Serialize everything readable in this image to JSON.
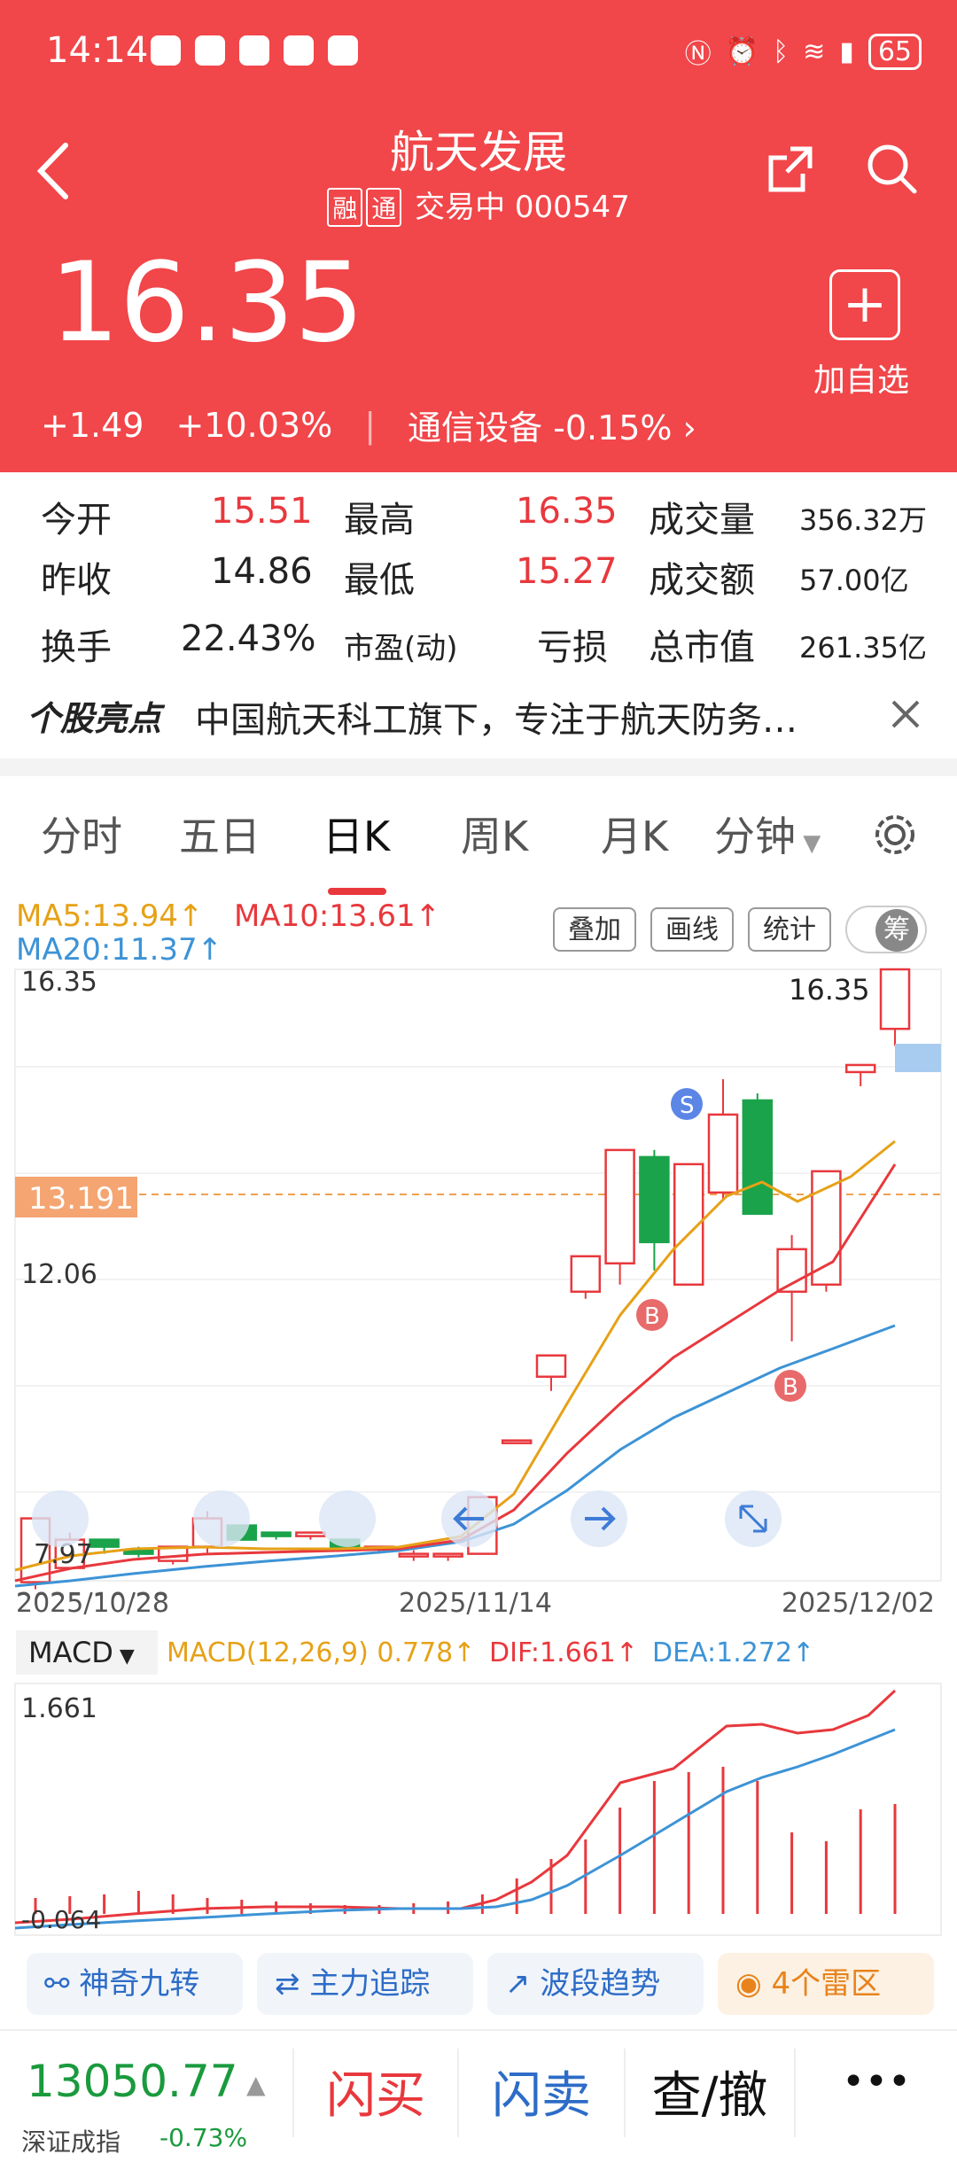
{
  "status_bar": {
    "time": "14:14",
    "battery": "65"
  },
  "header": {
    "title": "航天发展",
    "tags": [
      "融",
      "通"
    ],
    "trading_status": "交易中",
    "code": "000547",
    "price": "16.35",
    "change": "+1.49",
    "change_pct": "+10.03%",
    "sector": "通信设备",
    "sector_pct": "-0.15%",
    "add_watchlist": "加自选"
  },
  "stats": [
    {
      "label": "今开",
      "value": "15.51"
    },
    {
      "label": "最高",
      "value": "16.35"
    },
    {
      "label": "成交量",
      "value": "356.32万"
    },
    {
      "label": "昨收",
      "value": "14.86"
    },
    {
      "label": "最低",
      "value": "15.27"
    },
    {
      "label": "成交额",
      "value": "57.00亿"
    },
    {
      "label": "换手",
      "value": "22.43%"
    },
    {
      "label": "市盈(动)",
      "value": "亏损"
    },
    {
      "label": "总市值",
      "value": "261.35亿"
    }
  ],
  "highlight": {
    "brand": "个股亮点",
    "text": "中国航天科工旗下，专注于航天防务…"
  },
  "tabs": [
    "分时",
    "五日",
    "日K",
    "周K",
    "月K",
    "分钟"
  ],
  "chart": {
    "ma5": "MA5:13.94↑",
    "ma10": "MA10:13.61↑",
    "ma20": "MA20:11.37↑",
    "buttons": [
      "叠加",
      "画线",
      "统计",
      "筹"
    ],
    "y_top": "16.35",
    "y_mid": "12.06",
    "y_low": "7.97",
    "current_line": "13.191",
    "high_label": "16.35",
    "dates": [
      "2025/10/28",
      "2025/11/14",
      "2025/12/02"
    ],
    "signal_s": "S",
    "signal_b": "B"
  },
  "macd": {
    "selector": "MACD",
    "macd": "MACD(12,26,9)  0.778↑",
    "dif": "DIF:1.661↑",
    "dea": "DEA:1.272↑",
    "y_top": "1.661",
    "y_low": "-0.064"
  },
  "features": [
    "神奇九转",
    "主力追踪",
    "波段趋势",
    "4个雷区"
  ],
  "bottom": {
    "index_value": "13050.77",
    "index_name": "深证成指",
    "index_pct": "-0.73%",
    "buy": "闪买",
    "sell": "闪卖",
    "query": "查/撤",
    "more": "•••"
  },
  "chart_data": {
    "type": "candlestick",
    "x_start": "2025/10/28",
    "x_end": "2025/12/02",
    "ylim": [
      7.97,
      16.35
    ],
    "candles": [
      [
        8.6,
        7.7,
        7.97,
        7.6,
        "up"
      ],
      [
        8.3,
        7.9,
        8.4,
        8.2,
        "up"
      ],
      [
        8.2,
        8.3,
        8.3,
        8.1,
        "down"
      ],
      [
        8.1,
        8.15,
        8.2,
        8.05,
        "down"
      ],
      [
        8.0,
        8.2,
        8.1,
        7.95,
        "up"
      ],
      [
        8.2,
        8.6,
        8.7,
        8.1,
        "up"
      ],
      [
        8.3,
        8.5,
        8.4,
        8.3,
        "down"
      ],
      [
        8.35,
        8.4,
        8.4,
        8.3,
        "down"
      ],
      [
        8.4,
        8.35,
        8.35,
        8.3,
        "up"
      ],
      [
        8.3,
        8.2,
        8.3,
        8.15,
        "down"
      ],
      [
        8.2,
        8.2,
        8.2,
        8.1,
        "up"
      ],
      [
        8.1,
        8.1,
        8.15,
        8.0,
        "up"
      ],
      [
        8.1,
        8.1,
        8.1,
        8.0,
        "up"
      ],
      [
        8.1,
        8.9,
        8.9,
        8.1,
        "up"
      ],
      [
        9.7,
        9.7,
        9.7,
        9.7,
        "up"
      ],
      [
        10.6,
        10.9,
        10.9,
        10.4,
        "up"
      ],
      [
        11.8,
        12.3,
        12.3,
        11.7,
        "up"
      ],
      [
        12.2,
        13.8,
        13.8,
        11.9,
        "up"
      ],
      [
        13.7,
        12.5,
        13.8,
        12.1,
        "down"
      ],
      [
        11.9,
        13.6,
        13.6,
        11.9,
        "up"
      ],
      [
        13.2,
        14.3,
        14.8,
        13.1,
        "up"
      ],
      [
        14.5,
        12.9,
        14.6,
        12.9,
        "down"
      ],
      [
        11.8,
        12.4,
        12.6,
        11.1,
        "up"
      ],
      [
        11.9,
        13.5,
        13.5,
        11.8,
        "up"
      ],
      [
        14.9,
        15.0,
        15.0,
        14.7,
        "up"
      ],
      [
        15.51,
        16.35,
        16.35,
        15.27,
        "up"
      ]
    ]
  }
}
